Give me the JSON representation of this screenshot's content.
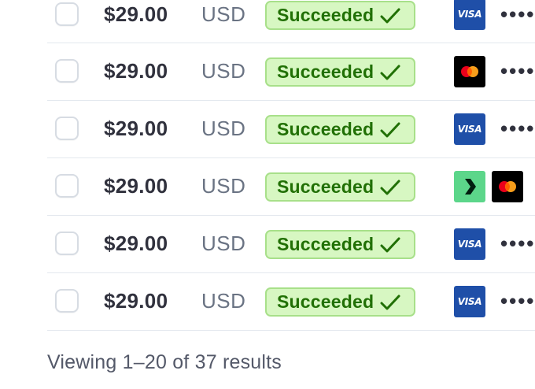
{
  "payments": {
    "rows": [
      {
        "amount": "$29.00",
        "currency": "USD",
        "status": "Succeeded",
        "payment_method": "visa-icon",
        "has_more_menu": true
      },
      {
        "amount": "$29.00",
        "currency": "USD",
        "status": "Succeeded",
        "payment_method": "mastercard-icon",
        "has_more_menu": true
      },
      {
        "amount": "$29.00",
        "currency": "USD",
        "status": "Succeeded",
        "payment_method": "visa-icon",
        "has_more_menu": true
      },
      {
        "amount": "$29.00",
        "currency": "USD",
        "status": "Succeeded",
        "payment_method": "link-icon + mastercard-icon",
        "has_more_menu": false
      },
      {
        "amount": "$29.00",
        "currency": "USD",
        "status": "Succeeded",
        "payment_method": "visa-icon",
        "has_more_menu": true
      },
      {
        "amount": "$29.00",
        "currency": "USD",
        "status": "Succeeded",
        "payment_method": "visa-icon",
        "has_more_menu": true
      }
    ],
    "visa_label": "VISA",
    "more_label": "••••"
  },
  "footer": {
    "results_text": "Viewing 1–20 of 37 results"
  },
  "colors": {
    "status_success_bg": "#d7f7c2",
    "status_success_border": "#a8e08a",
    "status_success_text": "#217005",
    "visa_blue": "#1f4fa8",
    "link_green": "#5cd68a"
  }
}
